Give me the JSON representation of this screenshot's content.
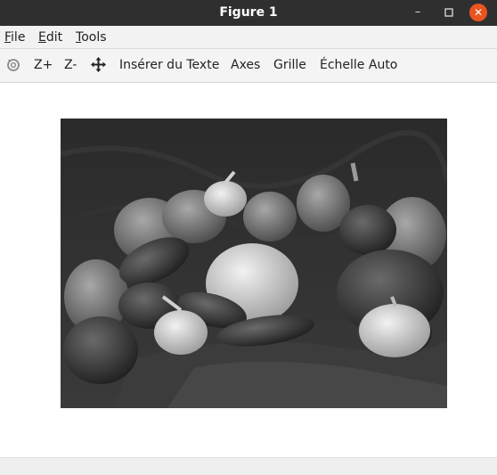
{
  "window": {
    "title": "Figure 1",
    "minimize_label": "–",
    "maximize_label": "□",
    "close_label": "✕"
  },
  "menubar": {
    "items": [
      {
        "label": "File"
      },
      {
        "label": "Edit"
      },
      {
        "label": "Tools"
      }
    ]
  },
  "toolbar": {
    "rotate_icon": "rotate-icon",
    "zoom_in_label": "Z+",
    "zoom_out_label": "Z-",
    "pan_icon": "pan-arrows-icon",
    "insert_text_label": "Insérer du Texte",
    "axes_label": "Axes",
    "grid_label": "Grille",
    "autoscale_label": "Échelle Auto"
  },
  "figure": {
    "image_subject": "grayscale photo of bell peppers and garlic on a draped cloth"
  },
  "colors": {
    "titlebar": "#2f2f2f",
    "close_button": "#e95420",
    "toolbar_bg": "#f4f4f4"
  }
}
